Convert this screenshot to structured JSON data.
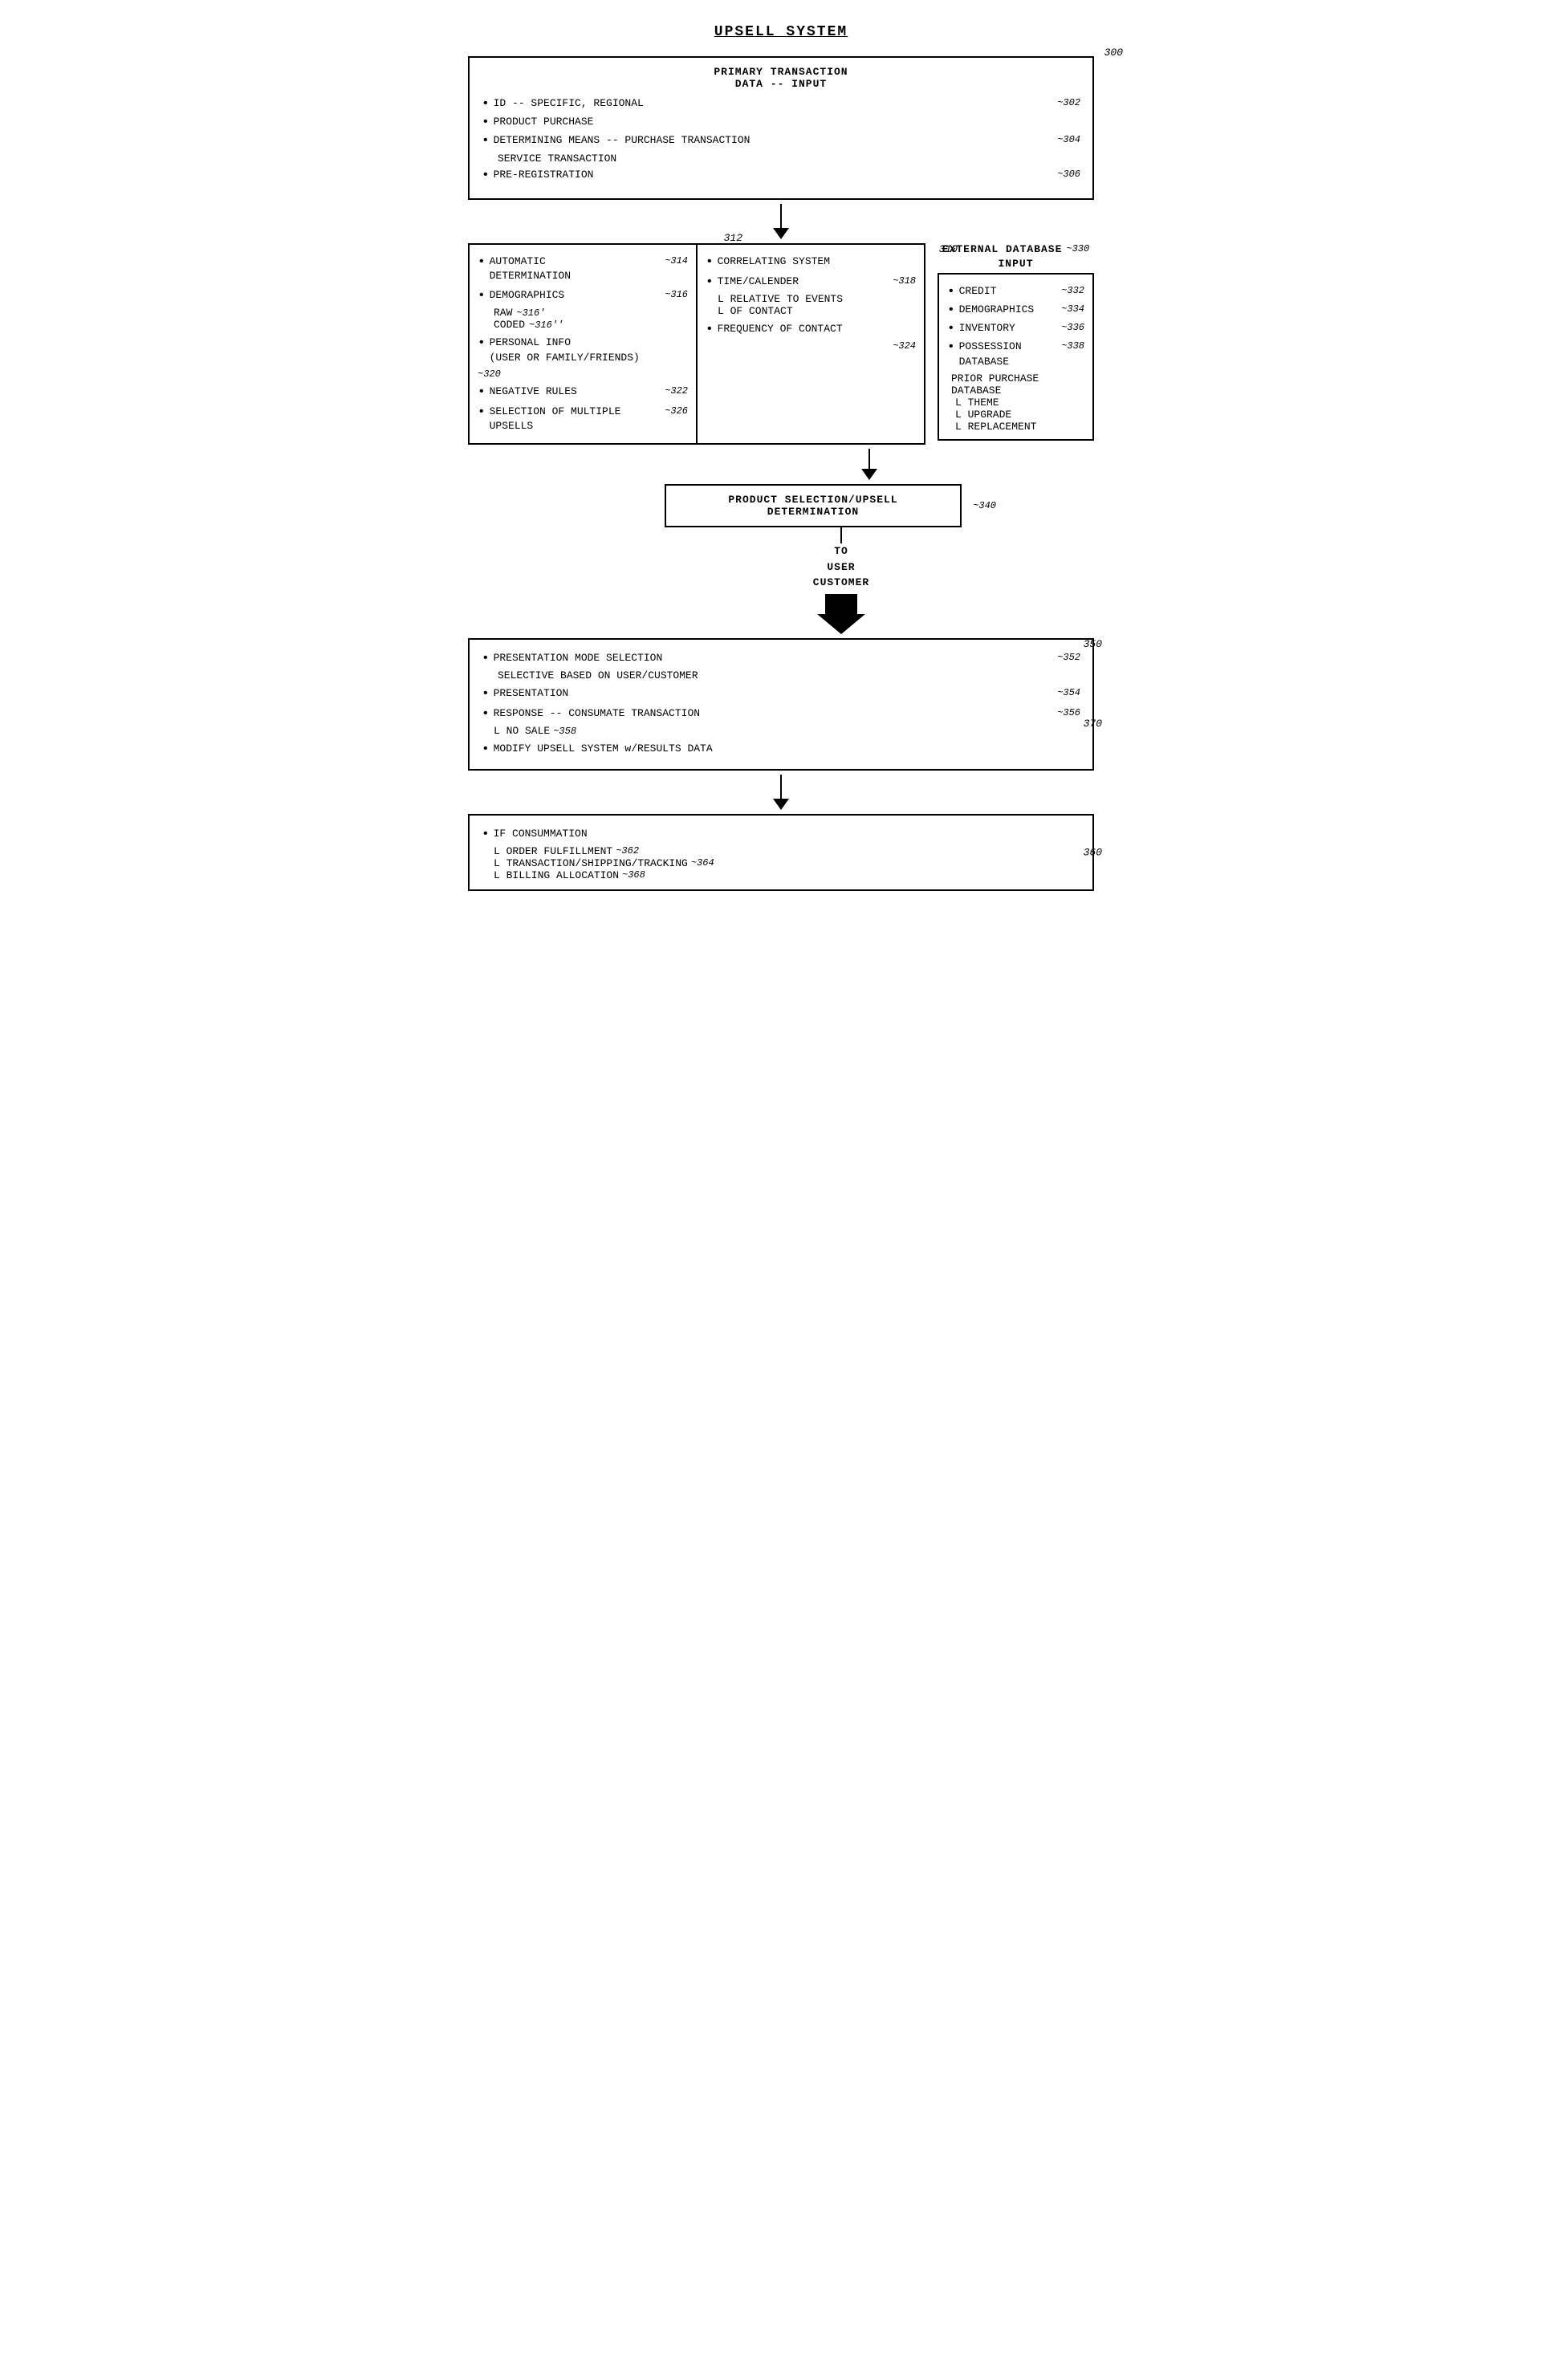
{
  "title": "UPSELL SYSTEM",
  "diagram": {
    "primary_box": {
      "ref": "300",
      "title_line1": "PRIMARY TRANSACTION",
      "title_line2": "DATA -- INPUT",
      "items": [
        {
          "bullet": "•",
          "text": "ID -- SPECIFIC, REGIONAL",
          "ref": "~302"
        },
        {
          "bullet": "•",
          "text": "PRODUCT PURCHASE",
          "ref": ""
        },
        {
          "bullet": "•",
          "text": "DETERMINING MEANS -- PURCHASE TRANSACTION",
          "ref": "~304",
          "sub": "SERVICE TRANSACTION"
        },
        {
          "bullet": "•",
          "text": "PRE-REGISTRATION",
          "ref": "~306"
        }
      ]
    },
    "box310": {
      "ref": "310",
      "ref_inner": "312",
      "left_items": [
        {
          "bullet": "•",
          "text": "AUTOMATIC DETERMINATION",
          "ref": "~314"
        },
        {
          "bullet": "•",
          "text": "DEMOGRAPHICS",
          "ref": "~316",
          "subs": [
            {
              "prefix": "RAW",
              "ref": "~316'"
            },
            {
              "prefix": "CODED",
              "ref": "~316''"
            }
          ]
        },
        {
          "bullet": "•",
          "text": "PERSONAL INFO",
          "sub2": "(USER OR FAMILY/FRIENDS)",
          "ref": "~320"
        },
        {
          "bullet": "•",
          "text": "NEGATIVE RULES",
          "ref": "~322"
        },
        {
          "bullet": "•",
          "text": "SELECTION OF MULTIPLE UPSELLS",
          "ref": "~326"
        }
      ],
      "right_items": [
        {
          "bullet": "•",
          "text": "CORRELATING SYSTEM"
        },
        {
          "bullet": "•",
          "text": "TIME/CALENDER",
          "ref": "~318",
          "subs": [
            {
              "prefix": "L RELATIVE TO EVENTS"
            },
            {
              "prefix": "L OF CONTACT"
            }
          ]
        },
        {
          "bullet": "•",
          "text": "FREQUENCY OF CONTACT",
          "ref": "~324"
        }
      ]
    },
    "external_db": {
      "label": "EXTERNAL DATABASE",
      "ref": "~330",
      "sub_label": "INPUT",
      "items": [
        {
          "bullet": "•",
          "text": "CREDIT",
          "ref": "~332"
        },
        {
          "bullet": "•",
          "text": "DEMOGRAPHICS",
          "ref": "~334"
        },
        {
          "bullet": "•",
          "text": "INVENTORY",
          "ref": "~336"
        },
        {
          "bullet": "•",
          "text": "POSSESSION DATABASE",
          "ref": "~338",
          "subs": [
            {
              "prefix": "PRIOR PURCHASE DATABASE"
            },
            {
              "prefix": "L THEME"
            },
            {
              "prefix": "L UPGRADE"
            },
            {
              "prefix": "L REPLACEMENT"
            }
          ]
        }
      ]
    },
    "product_sel": {
      "ref": "~340",
      "line1": "PRODUCT SELECTION/UPSELL",
      "line2": "DETERMINATION"
    },
    "to_user": {
      "line1": "TO",
      "line2": "USER",
      "line3": "CUSTOMER"
    },
    "presentation_box": {
      "ref": "350",
      "ref2": "370",
      "items": [
        {
          "bullet": "•",
          "text": "PRESENTATION MODE SELECTION",
          "sub": "SELECTIVE BASED ON USER/CUSTOMER",
          "ref": "~352"
        },
        {
          "bullet": "•",
          "text": "PRESENTATION",
          "ref": "~354"
        },
        {
          "bullet": "•",
          "text": "RESPONSE -- CONSUMATE TRANSACTION",
          "ref": "~356",
          "subs": [
            {
              "prefix": "L NO SALE",
              "ref": "~358"
            }
          ]
        },
        {
          "bullet": "•",
          "text": "MODIFY UPSELL SYSTEM w/RESULTS DATA"
        }
      ]
    },
    "final_box": {
      "ref": "360",
      "items": [
        {
          "bullet": "•",
          "text": "IF CONSUMMATION"
        },
        {
          "prefix": "L ORDER FULFILLMENT",
          "ref": "~362"
        },
        {
          "prefix": "L TRANSACTION/SHIPPING/TRACKING",
          "ref": "~364"
        },
        {
          "prefix": "L BILLING ALLOCATION",
          "ref": "~368"
        }
      ]
    }
  }
}
